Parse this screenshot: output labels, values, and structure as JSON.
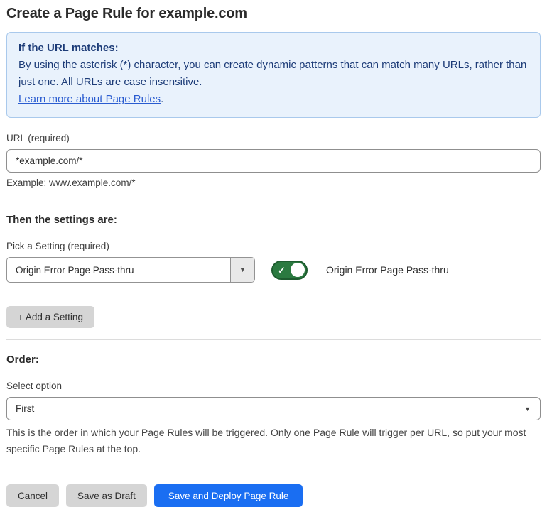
{
  "page": {
    "title": "Create a Page Rule for example.com"
  },
  "info_box": {
    "heading": "If the URL matches:",
    "body": "By using the asterisk (*) character, you can create dynamic patterns that can match many URLs, rather than just one. All URLs are case insensitive.",
    "link_label": "Learn more about Page Rules",
    "link_suffix": "."
  },
  "url_field": {
    "label": "URL (required)",
    "value": "*example.com/*",
    "helper": "Example: www.example.com/*"
  },
  "settings_section": {
    "heading": "Then the settings are:",
    "picker_label": "Pick a Setting (required)",
    "selected_setting": "Origin Error Page Pass-thru",
    "toggle_state": "on",
    "toggle_label": "Origin Error Page Pass-thru",
    "add_button_label": "+ Add a Setting"
  },
  "order_section": {
    "heading": "Order:",
    "select_label": "Select option",
    "selected_option": "First",
    "helper": "This is the order in which your Page Rules will be triggered. Only one Page Rule will trigger per URL, so put your most specific Page Rules at the top."
  },
  "footer": {
    "cancel_label": "Cancel",
    "save_draft_label": "Save as Draft",
    "save_deploy_label": "Save and Deploy Page Rule"
  },
  "colors": {
    "primary_blue": "#1a6ef2",
    "info_box_bg": "#e9f2fc",
    "info_box_border": "#a9c9ec",
    "info_box_text": "#1d3c78",
    "link_blue": "#2a5cd0",
    "toggle_green": "#2b7a40",
    "toggle_green_border": "#1e5c2f",
    "gray_button_bg": "#d5d5d5"
  },
  "icons": {
    "dropdown_arrow": "▼",
    "check": "✓"
  }
}
